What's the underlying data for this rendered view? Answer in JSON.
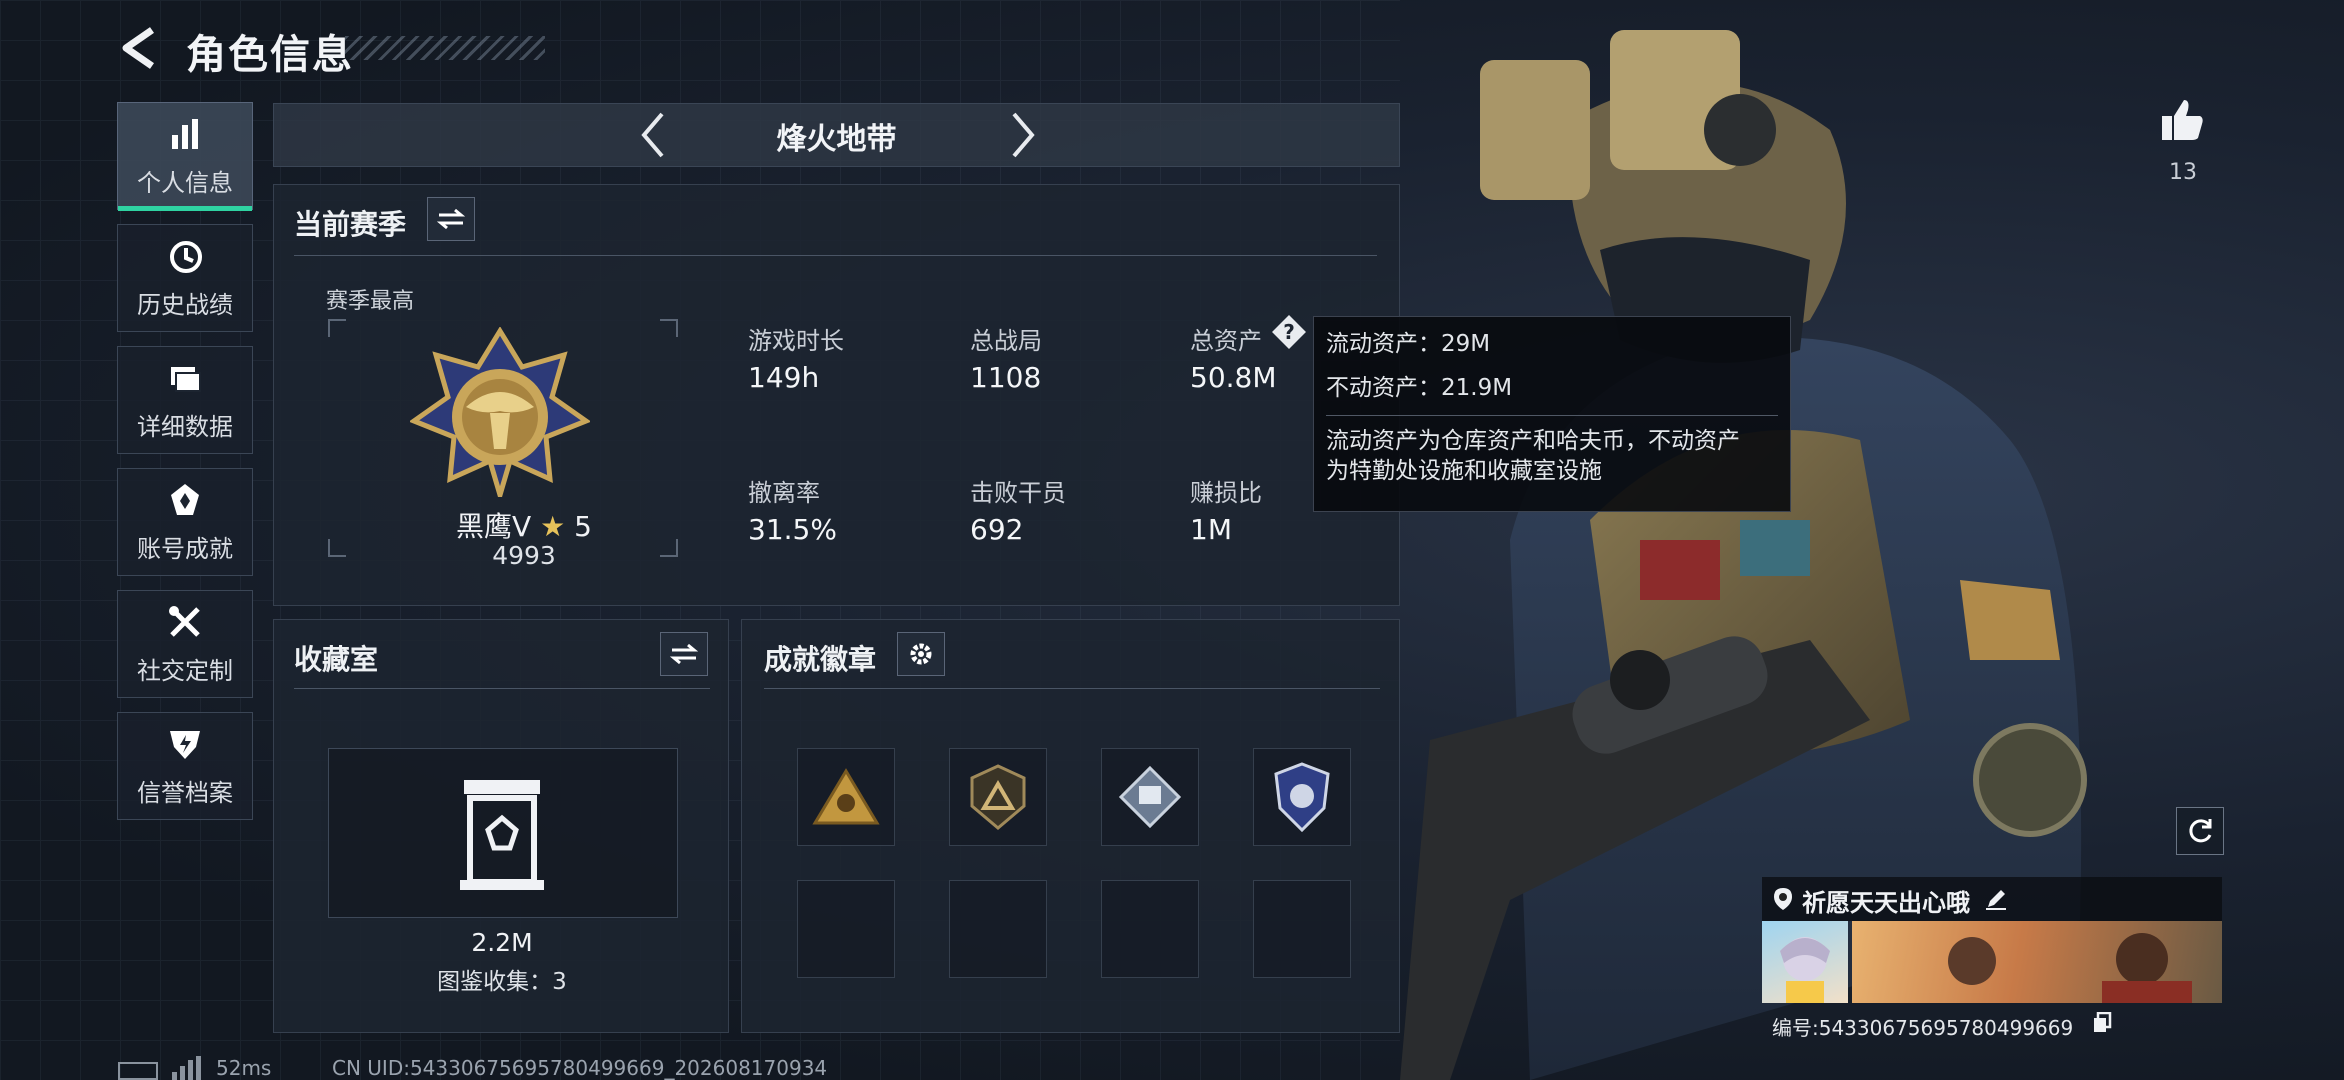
{
  "header": {
    "title": "角色信息"
  },
  "sidebar": {
    "items": [
      {
        "label": "个人信息",
        "icon": "bar-chart-icon"
      },
      {
        "label": "历史战绩",
        "icon": "history-clock-icon"
      },
      {
        "label": "详细数据",
        "icon": "folder-icon"
      },
      {
        "label": "账号成就",
        "icon": "achievement-icon"
      },
      {
        "label": "社交定制",
        "icon": "tools-icon"
      },
      {
        "label": "信誉档案",
        "icon": "shield-bolt-icon"
      }
    ],
    "active_index": 0
  },
  "mode": {
    "label": "烽火地带"
  },
  "season": {
    "title": "当前赛季",
    "best_label": "赛季最高",
    "rank_name": "黑鹰V",
    "rank_stars": "5",
    "rank_score": "4993",
    "stats": [
      {
        "label": "游戏时长",
        "value": "149h"
      },
      {
        "label": "总战局",
        "value": "1108"
      },
      {
        "label": "总资产",
        "value": "50.8M"
      },
      {
        "label": "撤离率",
        "value": "31.5%"
      },
      {
        "label": "击败干员",
        "value": "692"
      },
      {
        "label": "赚损比",
        "value": "1M"
      }
    ]
  },
  "tooltip": {
    "line1": "流动资产：29M",
    "line2": "不动资产：21.9M",
    "desc1": "流动资产为仓库资产和哈夫币，不动资产",
    "desc2": "为特勤处设施和收藏室设施"
  },
  "collection": {
    "title": "收藏室",
    "value": "2.2M",
    "count_label": "图鉴收集：3"
  },
  "badges": {
    "title": "成就徽章"
  },
  "likes": {
    "count": "13"
  },
  "profile": {
    "name": "祈愿天天出心哦",
    "id_text": "编号:543306756957804996​69"
  },
  "footer": {
    "ping": "52ms",
    "uid": "CN UID:543306756957804996​69_202608170934"
  },
  "colors": {
    "accent": "#2fd3a2",
    "tooltip_bg": "#08090e",
    "panel_bg": "#1c2430"
  }
}
